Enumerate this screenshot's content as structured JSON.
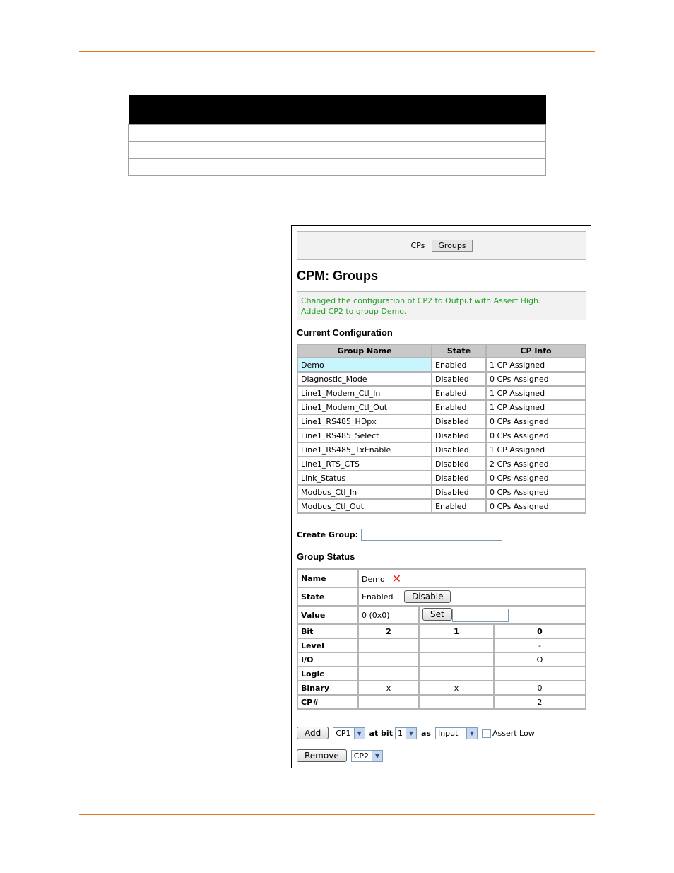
{
  "nav": {
    "tab_cps": "CPs",
    "tab_groups": "Groups"
  },
  "page_title": "CPM: Groups",
  "messages": [
    "Changed the configuration of CP2 to Output with Assert High.",
    "Added CP2 to group Demo."
  ],
  "current_configuration": {
    "title": "Current Configuration",
    "headers": [
      "Group Name",
      "State",
      "CP Info"
    ],
    "rows": [
      {
        "name": "Demo",
        "state": "Enabled",
        "info": "1 CP Assigned"
      },
      {
        "name": "Diagnostic_Mode",
        "state": "Disabled",
        "info": "0 CPs Assigned"
      },
      {
        "name": "Line1_Modem_Ctl_In",
        "state": "Enabled",
        "info": "1 CP Assigned"
      },
      {
        "name": "Line1_Modem_Ctl_Out",
        "state": "Enabled",
        "info": "1 CP Assigned"
      },
      {
        "name": "Line1_RS485_HDpx",
        "state": "Disabled",
        "info": "0 CPs Assigned"
      },
      {
        "name": "Line1_RS485_Select",
        "state": "Disabled",
        "info": "0 CPs Assigned"
      },
      {
        "name": "Line1_RS485_TxEnable",
        "state": "Disabled",
        "info": "1 CP Assigned"
      },
      {
        "name": "Line1_RTS_CTS",
        "state": "Disabled",
        "info": "2 CPs Assigned"
      },
      {
        "name": "Link_Status",
        "state": "Disabled",
        "info": "0 CPs Assigned"
      },
      {
        "name": "Modbus_Ctl_In",
        "state": "Disabled",
        "info": "0 CPs Assigned"
      },
      {
        "name": "Modbus_Ctl_Out",
        "state": "Enabled",
        "info": "0 CPs Assigned"
      }
    ]
  },
  "create_group": {
    "label": "Create Group:",
    "value": ""
  },
  "group_status": {
    "title": "Group Status",
    "name_label": "Name",
    "name_value": "Demo",
    "state_label": "State",
    "state_value": "Enabled",
    "disable_button": "Disable",
    "value_label": "Value",
    "value_value": "0 (0x0)",
    "set_button": "Set",
    "bit_label": "Bit",
    "bits": [
      "2",
      "1",
      "0"
    ],
    "level_label": "Level",
    "level": [
      "",
      "",
      "-"
    ],
    "io_label": "I/O",
    "io": [
      "",
      "",
      "O"
    ],
    "logic_label": "Logic",
    "logic": [
      "",
      "",
      ""
    ],
    "binary_label": "Binary",
    "binary": [
      "x",
      "x",
      "0"
    ],
    "cpnum_label": "CP#",
    "cpnum": [
      "",
      "",
      "2"
    ]
  },
  "add_row": {
    "add_button": "Add",
    "cp_select": "CP1",
    "at_bit_label": "at bit",
    "bit_select": "1",
    "as_label": "as",
    "mode_select": "Input",
    "assert_low_label": "Assert Low"
  },
  "remove_row": {
    "remove_button": "Remove",
    "cp_select": "CP2"
  },
  "colors": {
    "accent_rule": "#e8761e",
    "message_text": "#22a022",
    "selected_row": "#c9f5ff",
    "delete_icon": "#e8201a"
  }
}
